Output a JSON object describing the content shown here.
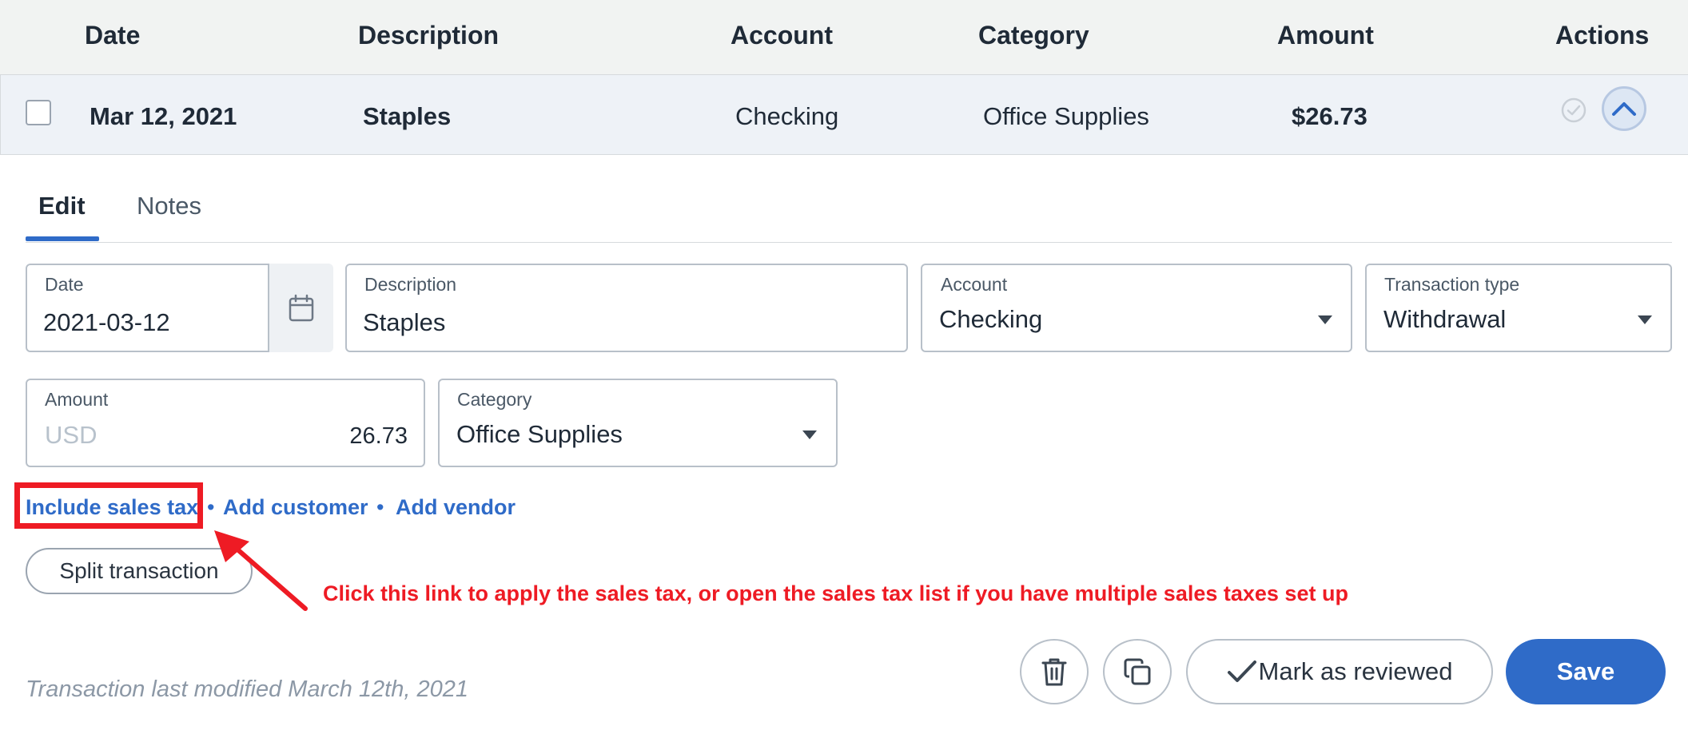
{
  "table": {
    "headers": {
      "date": "Date",
      "description": "Description",
      "account": "Account",
      "category": "Category",
      "amount": "Amount",
      "actions": "Actions"
    },
    "row": {
      "date": "Mar 12, 2021",
      "description": "Staples",
      "account": "Checking",
      "category": "Office Supplies",
      "amount": "$26.73"
    }
  },
  "tabs": {
    "edit": "Edit",
    "notes": "Notes"
  },
  "form": {
    "date": {
      "label": "Date",
      "value": "2021-03-12"
    },
    "description": {
      "label": "Description",
      "value": "Staples"
    },
    "account": {
      "label": "Account",
      "value": "Checking"
    },
    "transaction_type": {
      "label": "Transaction type",
      "value": "Withdrawal"
    },
    "amount": {
      "label": "Amount",
      "currency": "USD",
      "value": "26.73"
    },
    "category": {
      "label": "Category",
      "value": "Office Supplies"
    }
  },
  "links": {
    "include_sales_tax": "Include sales tax",
    "separator": "•",
    "add_customer": "Add customer",
    "add_vendor": "Add vendor"
  },
  "split_button": "Split transaction",
  "annotation": "Click this link to apply the sales tax, or open the sales tax list if you have multiple sales taxes set up",
  "footer": {
    "last_modified": "Transaction last modified March 12th, 2021",
    "mark_reviewed": "Mark as reviewed",
    "save": "Save"
  },
  "colors": {
    "accent": "#2f6bc8",
    "annotation_red": "#ee1b24",
    "header_bg": "#f1f3f2",
    "row_bg": "#eef2f7"
  }
}
